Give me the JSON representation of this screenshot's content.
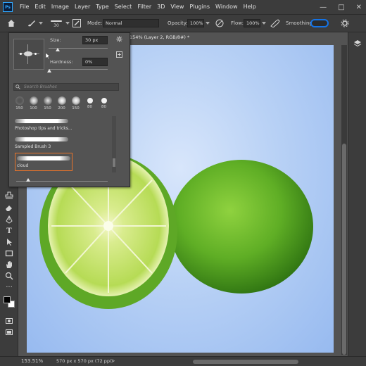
{
  "menubar": {
    "logo": "Ps",
    "items": [
      "File",
      "Edit",
      "Image",
      "Layer",
      "Type",
      "Select",
      "Filter",
      "3D",
      "View",
      "Plugins",
      "Window",
      "Help"
    ]
  },
  "options": {
    "brush_size": "30",
    "mode_label": "Mode:",
    "mode_value": "Normal",
    "opacity_label": "Opacity:",
    "opacity_value": "100%",
    "flow_label": "Flow:",
    "flow_value": "100%",
    "smoothing_label": "Smoothing"
  },
  "document_tab": {
    "title": "154% (Layer 2, RGB/8#) *"
  },
  "brush_panel": {
    "size_label": "Size:",
    "size_value": "30 px",
    "hardness_label": "Hardness:",
    "hardness_value": "0%",
    "search_placeholder": "Search Brushes",
    "tips": [
      {
        "size": "150"
      },
      {
        "size": "100"
      },
      {
        "size": "150"
      },
      {
        "size": "200"
      },
      {
        "size": "150"
      },
      {
        "size": "80"
      },
      {
        "size": "80"
      }
    ],
    "brushes": [
      {
        "name": "Photoshop tips and tricks..."
      },
      {
        "name": "Sampled Brush 3"
      },
      {
        "name": "cloud"
      }
    ],
    "selected_brush": "cloud"
  },
  "status": {
    "zoom": "153.51%",
    "doc_info": "570 px x 570 px (72 ppi)"
  },
  "colors": {
    "ui_dark": "#3c3c3c",
    "ui_mid": "#535353",
    "accent_blue": "#1473e6",
    "selection_orange": "#e8742a",
    "canvas_blue": "#b8d1f5",
    "lime": "#6fb329"
  }
}
